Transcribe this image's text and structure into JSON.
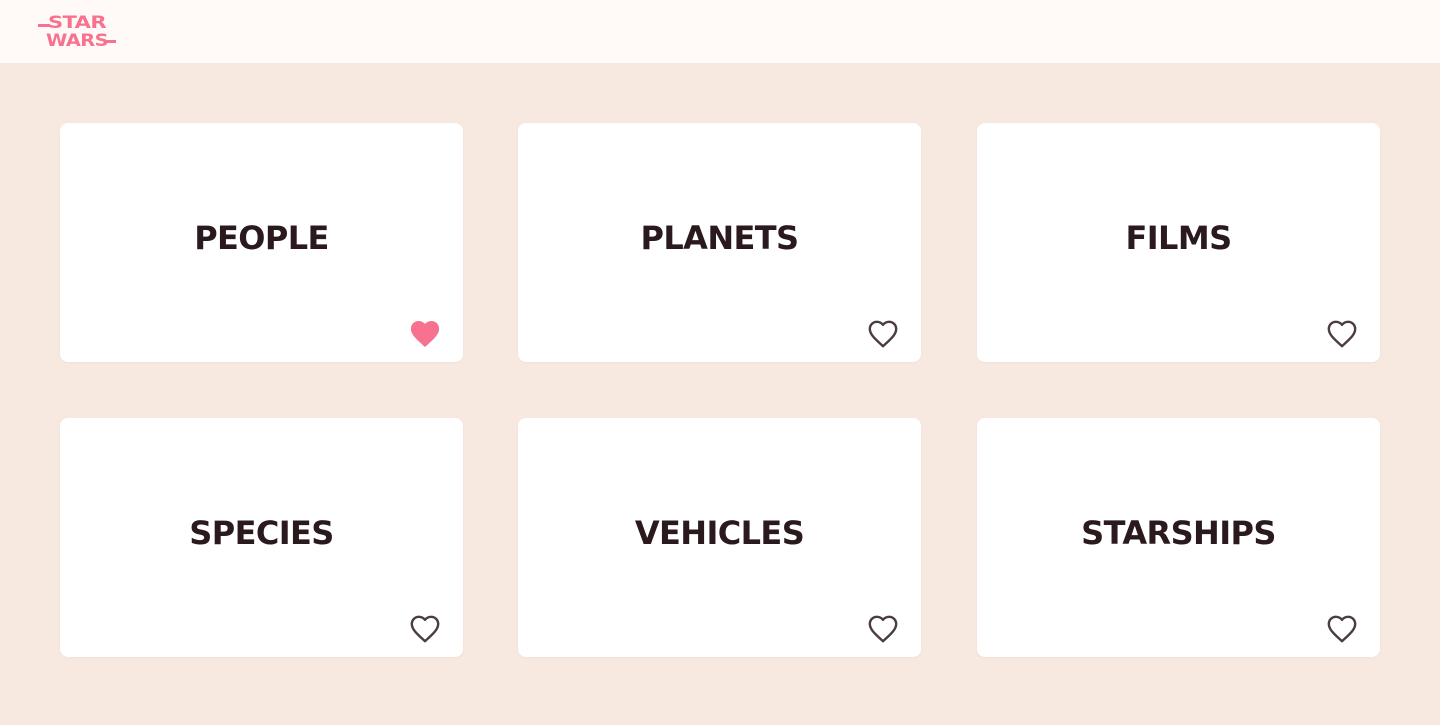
{
  "header": {
    "logo": {
      "line1": "STAR",
      "line2": "WARS",
      "color": "#f7728f"
    }
  },
  "colors": {
    "background": "#f7e8e0",
    "header_background": "#fffaf8",
    "card_background": "#ffffff",
    "title_text": "#2a191d",
    "heart_outline": "#4a3c40",
    "heart_filled": "#f7728f"
  },
  "categories": [
    {
      "label": "PEOPLE",
      "favorite": true,
      "icon": "heart-filled-icon"
    },
    {
      "label": "PLANETS",
      "favorite": false,
      "icon": "heart-outline-icon"
    },
    {
      "label": "FILMS",
      "favorite": false,
      "icon": "heart-outline-icon"
    },
    {
      "label": "SPECIES",
      "favorite": false,
      "icon": "heart-outline-icon"
    },
    {
      "label": "VEHICLES",
      "favorite": false,
      "icon": "heart-outline-icon"
    },
    {
      "label": "STARSHIPS",
      "favorite": false,
      "icon": "heart-outline-icon"
    }
  ]
}
